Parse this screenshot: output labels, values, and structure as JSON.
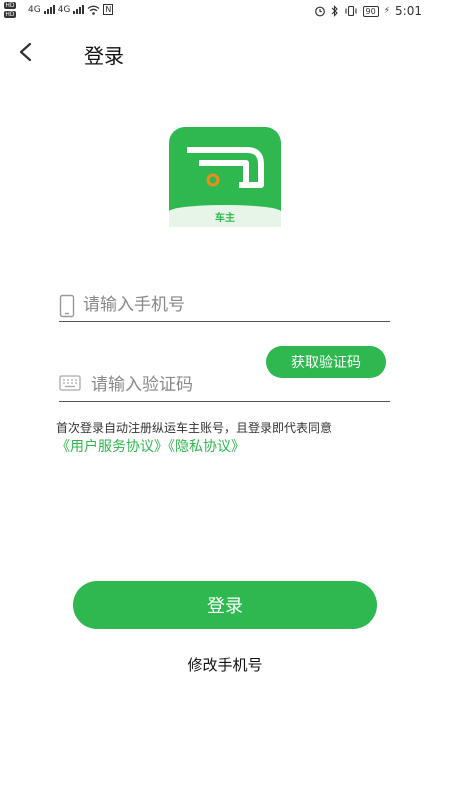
{
  "status_bar": {
    "hd_labels": [
      "HD",
      "HD"
    ],
    "network": [
      "4G",
      "4G"
    ],
    "nfc": "N",
    "battery": "90",
    "time": "5:01"
  },
  "header": {
    "title": "登录"
  },
  "logo": {
    "text": "车主",
    "brand_color": "#2eb84f"
  },
  "form": {
    "phone_placeholder": "请输入手机号",
    "phone_value": "",
    "code_placeholder": "请输入验证码",
    "code_value": "",
    "get_code_label": "获取验证码"
  },
  "agreement": {
    "text": "首次登录自动注册纵运车主账号，且登录即代表同意",
    "user_agreement": "《用户服务协议》",
    "privacy_agreement": "《隐私协议》"
  },
  "actions": {
    "login_label": "登录",
    "change_phone_label": "修改手机号"
  },
  "colors": {
    "accent": "#2eb84f",
    "text": "#222222",
    "placeholder": "#888888"
  }
}
